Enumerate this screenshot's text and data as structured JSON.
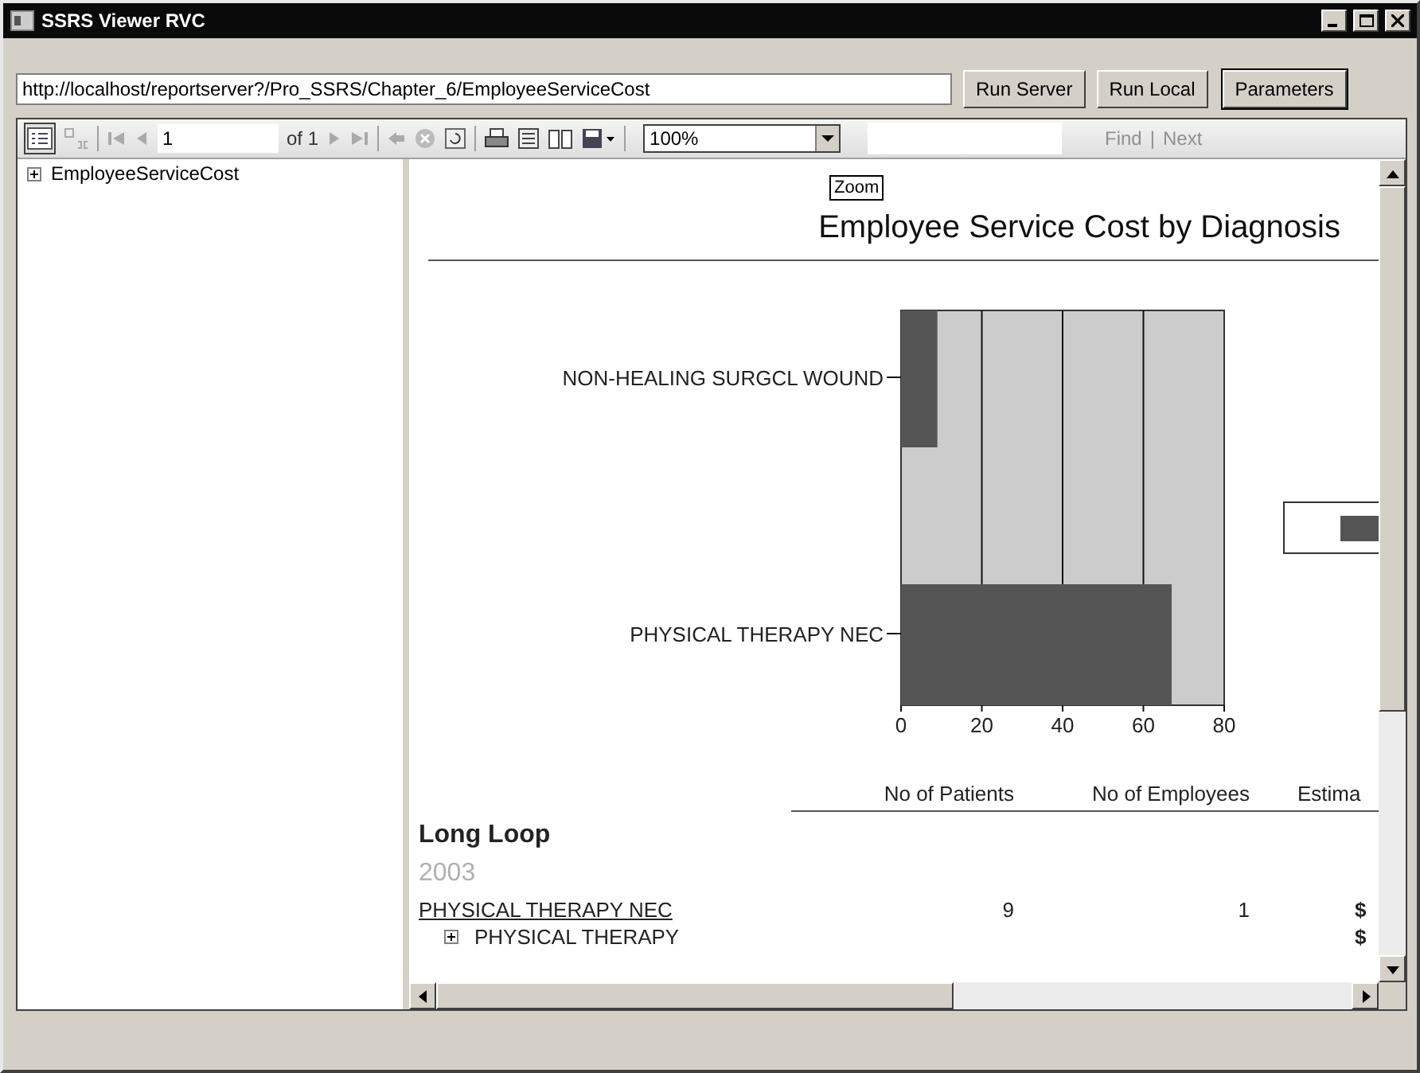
{
  "window": {
    "title": "SSRS Viewer RVC"
  },
  "url_field": {
    "value": "http://localhost/reportserver?/Pro_SSRS/Chapter_6/EmployeeServiceCost"
  },
  "buttons": [
    {
      "label": "Run Server",
      "focused": false
    },
    {
      "label": "Run Local",
      "focused": false
    },
    {
      "label": "Parameters",
      "focused": true
    }
  ],
  "toolbar": {
    "doc_map_on": true,
    "page": "1",
    "page_count": "of 1",
    "zoom": "100%",
    "find_label": "Find",
    "separator": "|",
    "next_label": "Next",
    "find_disabled": true
  },
  "document_map": {
    "items": [
      {
        "label": "EmployeeServiceCost",
        "expanded": false
      }
    ]
  },
  "report": {
    "zoom_button": "Zoom",
    "title": "Employee Service Cost by Diagnosis",
    "chart_data": {
      "type": "bar",
      "orientation": "horizontal",
      "categories": [
        "NON-HEALING SURGCL WOUND",
        "PHYSICAL THERAPY NEC"
      ],
      "series": [
        {
          "color": "#555555",
          "values": [
            9,
            67
          ]
        }
      ],
      "xlim": [
        0,
        80
      ],
      "grid": true,
      "xticks": [
        0,
        20,
        40,
        60,
        80
      ]
    },
    "table": {
      "columns": [
        "No of Patients",
        "No of Employees",
        "Estima"
      ],
      "group": "Long Loop",
      "year": "2003",
      "rows": [
        {
          "kind": "link",
          "label": "PHYSICAL THERAPY NEC",
          "patients": "9",
          "employees": "1",
          "cost": "$"
        },
        {
          "kind": "detail",
          "label": "PHYSICAL THERAPY",
          "expanded": false,
          "cost": "$"
        }
      ]
    }
  }
}
